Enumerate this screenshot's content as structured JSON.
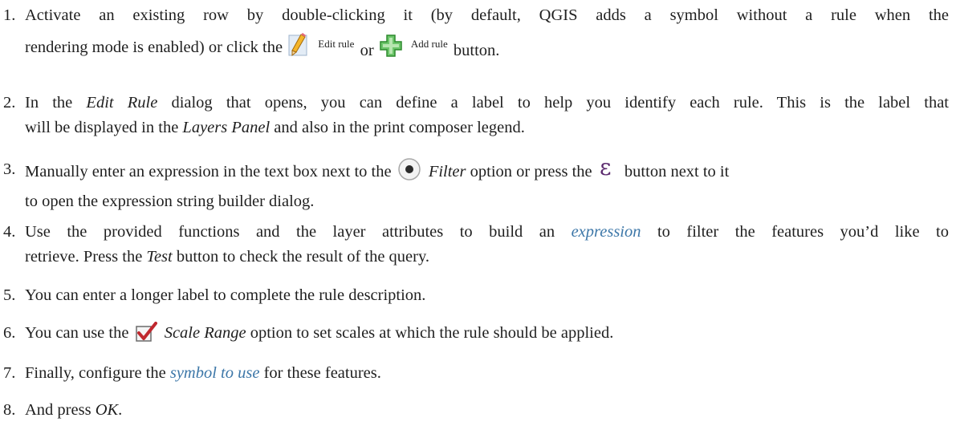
{
  "steps": [
    {
      "number": "1.",
      "line1": "Activate an existing row by double-clicking it (by default, QGIS adds a symbol without a rule when the",
      "line2_before": "rendering mode is enabled) or click the",
      "edit_label": "Edit rule",
      "or_text": "or",
      "add_label": "Add rule",
      "line2_after": "button.",
      "icons": [
        "pencil-edit-icon",
        "green-plus-add-icon"
      ]
    },
    {
      "number": "2.",
      "t1": "In the ",
      "e1": "Edit Rule",
      "t2": " dialog that opens, you can define a label to help you identify each rule. This is the label that",
      "t3": "will be displayed in the ",
      "e2": "Layers Panel",
      "t4": " and also in the print composer legend."
    },
    {
      "number": "3.",
      "t1": "Manually enter an expression in the text box next to the",
      "e1": "Filter",
      "t2": "option or press the",
      "t3": "button next to it",
      "t4": "to open the expression string builder dialog.",
      "icons": [
        "radio-selected-icon",
        "epsilon-expression-icon"
      ]
    },
    {
      "number": "4.",
      "t1": "Use the provided functions and the layer attributes to build an ",
      "link": "expression",
      "t2": " to filter the features you’d like to",
      "t3": "retrieve. Press the ",
      "e1": "Test",
      "t4": " button to check the result of the query."
    },
    {
      "number": "5.",
      "t1": "You can enter a longer label to complete the rule description."
    },
    {
      "number": "6.",
      "t1": "You can use the",
      "e1": "Scale Range",
      "t2": "option to set scales at which the rule should be applied.",
      "icons": [
        "checkbox-checked-icon"
      ]
    },
    {
      "number": "7.",
      "t1": "Finally, configure the ",
      "link": "symbol to use",
      "t2": " for these features."
    },
    {
      "number": "8.",
      "t1": "And press ",
      "e1": "OK",
      "t2": "."
    }
  ],
  "colors": {
    "text": "#1f1f1f",
    "link": "#3d77a8",
    "add_icon": "#3aa03a",
    "epsilon": "#5b2a6e",
    "check": "#c0282e"
  }
}
